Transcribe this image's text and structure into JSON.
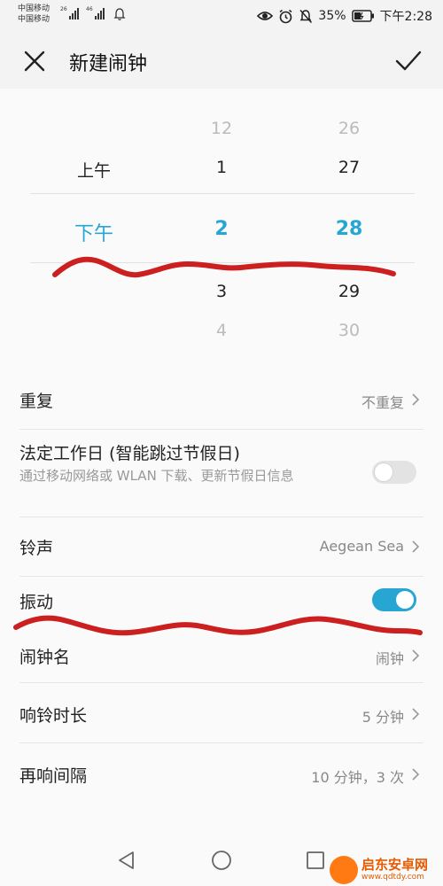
{
  "status_bar": {
    "carrier_1": "中国移动",
    "carrier_2": "中国移动",
    "sim1_network": "26",
    "sim2_network": "46",
    "battery": "35%",
    "time": "下午2:28",
    "icons": [
      "eye-icon",
      "alarm-icon",
      "mute-bell-icon",
      "battery-icon"
    ]
  },
  "header": {
    "title": "新建闹钟",
    "close_icon": "close-icon",
    "confirm_icon": "check-icon"
  },
  "picker": {
    "ampm": {
      "above": "上午",
      "selected": "下午"
    },
    "hour": {
      "above2": "12",
      "above1": "1",
      "selected": "2",
      "below1": "3",
      "below2": "4"
    },
    "minute": {
      "above2": "26",
      "above1": "27",
      "selected": "28",
      "below1": "29",
      "below2": "30"
    }
  },
  "settings": {
    "repeat": {
      "label": "重复",
      "value": "不重复"
    },
    "workday": {
      "label": "法定工作日 (智能跳过节假日)",
      "sub": "通过移动网络或 WLAN 下载、更新节假日信息",
      "enabled": false
    },
    "ringtone": {
      "label": "铃声",
      "value": "Aegean Sea"
    },
    "vibrate": {
      "label": "振动",
      "enabled": true
    },
    "name": {
      "label": "闹钟名",
      "value": "闹钟"
    },
    "duration": {
      "label": "响铃时长",
      "value": "5 分钟"
    },
    "snooze": {
      "label": "再响间隔",
      "value": "10 分钟，3 次"
    }
  },
  "nav": [
    "back-icon",
    "home-icon",
    "recents-icon"
  ],
  "watermark": {
    "title": "启东安卓网",
    "url": "www.qdtdy.com"
  },
  "colors": {
    "accent": "#27a6d4",
    "annotation": "#cc1f1f",
    "background": "#fafafa"
  }
}
